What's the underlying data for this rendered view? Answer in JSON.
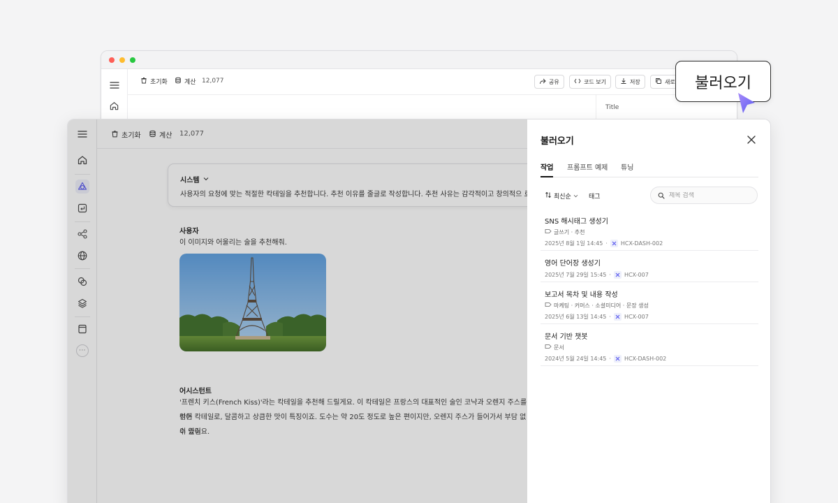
{
  "back_window": {
    "toolbar": {
      "reset_label": "초기화",
      "calc_label": "계산",
      "token_count": "12,077",
      "share_label": "공유",
      "code_view_label": "코드 보기",
      "save_label": "저장",
      "new_label": "새로"
    },
    "right_panel": {
      "title_label": "Title"
    }
  },
  "front_window": {
    "toolbar": {
      "reset_label": "초기화",
      "calc_label": "계산",
      "token_count": "12,077"
    },
    "chat": {
      "system": {
        "label": "시스템",
        "text": "사용자의 요청에 맞는 적절한 칵테일을 추천합니다. 추천 이유를 줄글로 작성합니다. 추천 사유는 감각적이고 창의적으 로···"
      },
      "user": {
        "label": "사용자",
        "text": "이 이미지와 어울리는 술을 추천해줘."
      },
      "assistant": {
        "label": "어시스턴트",
        "lines": [
          "'프렌치 키스(French Kiss)'라는 칵테일을 추천해 드릴게요. 이 칵테일은 프랑스의 대표적인 술인 코냑과 오렌지 주스를 섞어",
          "만든 칵테일로, 달콤하고 상큼한 맛이 특징이죠. 도수는 약 20도 정도로 높은 편이지만, 오렌지 주스가 들어가서 부담 없이 즐길",
          "수 있어요."
        ]
      }
    }
  },
  "drawer": {
    "title": "불러오기",
    "tabs": [
      {
        "label": "작업",
        "active": true
      },
      {
        "label": "프롬프트 예제",
        "active": false
      },
      {
        "label": "튜닝",
        "active": false
      }
    ],
    "sort_label": "최신순",
    "tag_label": "태그",
    "search_placeholder": "제목 검색",
    "items": [
      {
        "title": "SNS 해시태그 생성기",
        "tags": "글쓰기 · 추천",
        "date": "2025년 8월 1일 14:45",
        "model": "HCX-DASH-002"
      },
      {
        "title": "영어 단어장 생성기",
        "tags": "",
        "date": "2025년 7월 29일 15:45",
        "model": "HCX-007"
      },
      {
        "title": "보고서 목차 및 내용 작성",
        "tags": "마케팅 · 커머스 · 소셜미디어 · 문장 생성",
        "date": "2025년 6월 13일 14:45",
        "model": "HCX-007"
      },
      {
        "title": "문서 기반 챗봇",
        "tags": "문서",
        "date": "2024년 5월 24일 14:45",
        "model": "HCX-DASH-002"
      }
    ]
  },
  "callout": {
    "label": "불러오기"
  },
  "colors": {
    "accent": "#5b5bf0",
    "cursor": "#7b61ff"
  }
}
